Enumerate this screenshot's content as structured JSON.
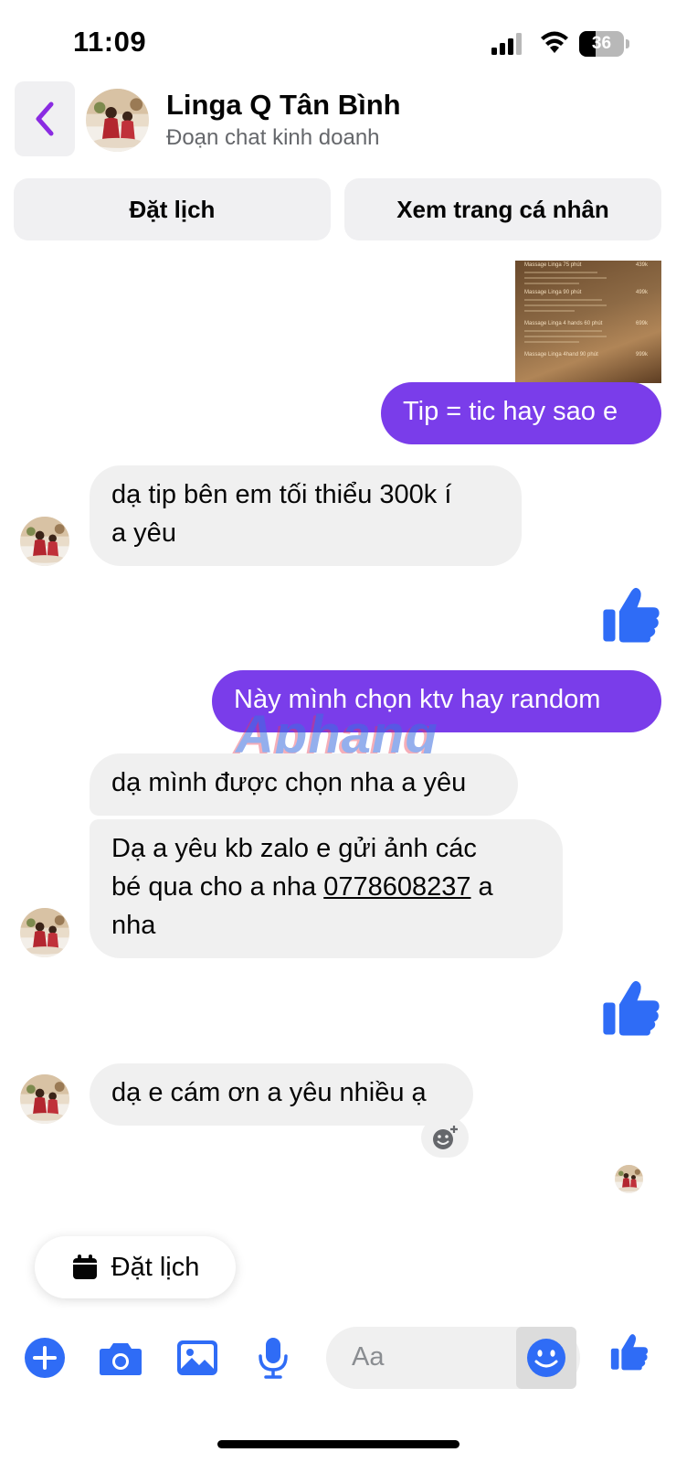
{
  "status_bar": {
    "time": "11:09",
    "battery_level": "36",
    "icons": [
      "signal-icon",
      "wifi-icon",
      "battery-icon"
    ]
  },
  "header": {
    "title": "Linga Q Tân Bình",
    "subtitle": "Đoạn chat kinh doanh",
    "back_icon": "chevron-left-icon"
  },
  "actions": {
    "book_label": "Đặt lịch",
    "profile_label": "Xem trang cá nhân"
  },
  "image_attachment": {
    "lines": [
      {
        "name": "Massage Linga 75 phút",
        "price": "439k"
      },
      {
        "name": "Massage Linga 90 phút",
        "price": "499k"
      },
      {
        "name": "Massage Linga 4 hands 60 phút",
        "price": "699k"
      },
      {
        "name": "Massage Linga 4hand 90 phút",
        "price": "999k"
      }
    ]
  },
  "messages": [
    {
      "from": "me",
      "text": "Tip = tic hay sao e"
    },
    {
      "from": "them",
      "text_lines": [
        "dạ tip bên em tối thiểu 300k í",
        "a yêu"
      ]
    },
    {
      "from": "me",
      "type": "like"
    },
    {
      "from": "me",
      "text": "Này mình chọn ktv hay random"
    },
    {
      "from": "them",
      "text": "dạ mình được chọn nha a yêu"
    },
    {
      "from": "them",
      "text_before": "Dạ a yêu kb zalo e gửi ảnh các",
      "text_mid": "bé qua cho a nha ",
      "phone": "0778608237",
      "text_after": " a",
      "text_end": "nha"
    },
    {
      "from": "me",
      "type": "like"
    },
    {
      "from": "them",
      "text": "dạ e cám ơn a yêu nhiều ạ"
    }
  ],
  "watermark": "Aphang",
  "floating_chip": {
    "label": "Đặt lịch",
    "icon": "calendar-icon"
  },
  "composer": {
    "placeholder": "Aa",
    "icons": [
      "plus-icon",
      "camera-icon",
      "image-icon",
      "microphone-icon",
      "emoji-icon",
      "thumbs-up-icon"
    ]
  },
  "colors": {
    "sent_bubble": "#7a3dea",
    "received_bubble": "#f0f0f0",
    "accent": "#2f6cf6",
    "back_chevron": "#8a2be2"
  }
}
